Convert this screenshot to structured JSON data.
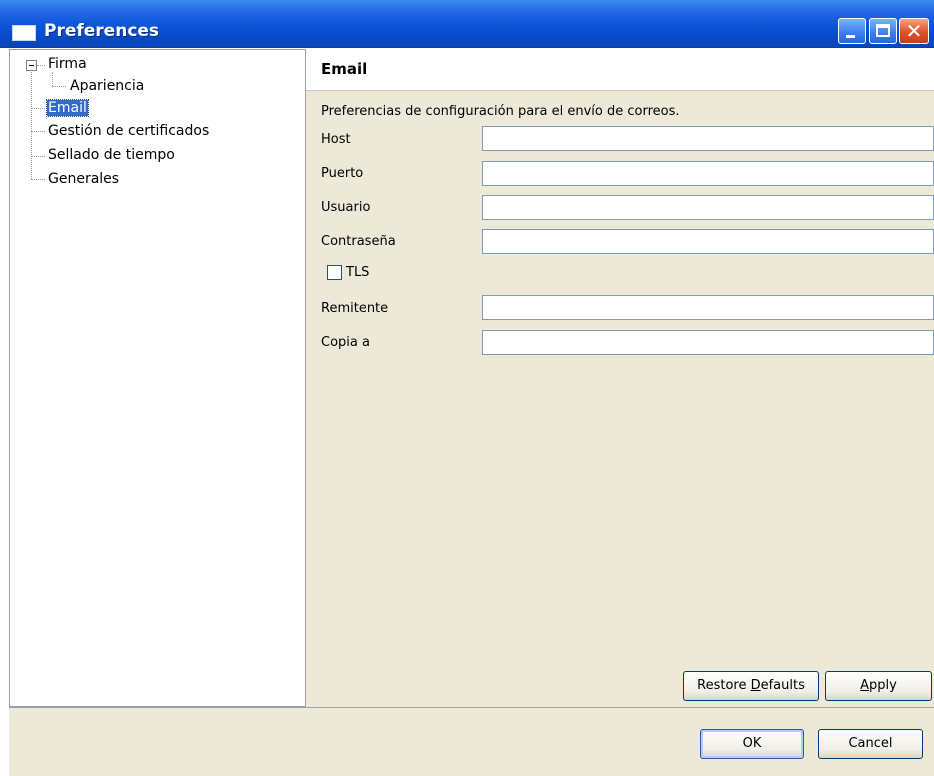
{
  "window": {
    "title": "Preferences"
  },
  "tree": {
    "items": [
      {
        "label": "Firma",
        "expanded": true
      },
      {
        "label": "Apariencia"
      },
      {
        "label": "Email",
        "selected": true
      },
      {
        "label": "Gestión de certificados"
      },
      {
        "label": "Sellado de tiempo"
      },
      {
        "label": "Generales"
      }
    ]
  },
  "page": {
    "title": "Email",
    "description": "Preferencias de configuración para el envío de correos.",
    "fields": [
      {
        "label": "Host",
        "value": ""
      },
      {
        "label": "Puerto",
        "value": ""
      },
      {
        "label": "Usuario",
        "value": ""
      },
      {
        "label": "Contraseña",
        "value": ""
      },
      {
        "label": "Remitente",
        "value": ""
      },
      {
        "label": "Copia a",
        "value": ""
      }
    ],
    "tls": {
      "label": "TLS",
      "checked": false
    },
    "buttons": {
      "restore_pre": "Restore ",
      "restore_mnemonic": "D",
      "restore_post": "efaults",
      "apply_mnemonic": "A",
      "apply_post": "pply"
    }
  },
  "dialog_buttons": {
    "ok": "OK",
    "cancel": "Cancel"
  },
  "colors": {
    "titlebar": "#0a55d8",
    "selection": "#3169c6",
    "pane_background": "#ece9d8"
  }
}
